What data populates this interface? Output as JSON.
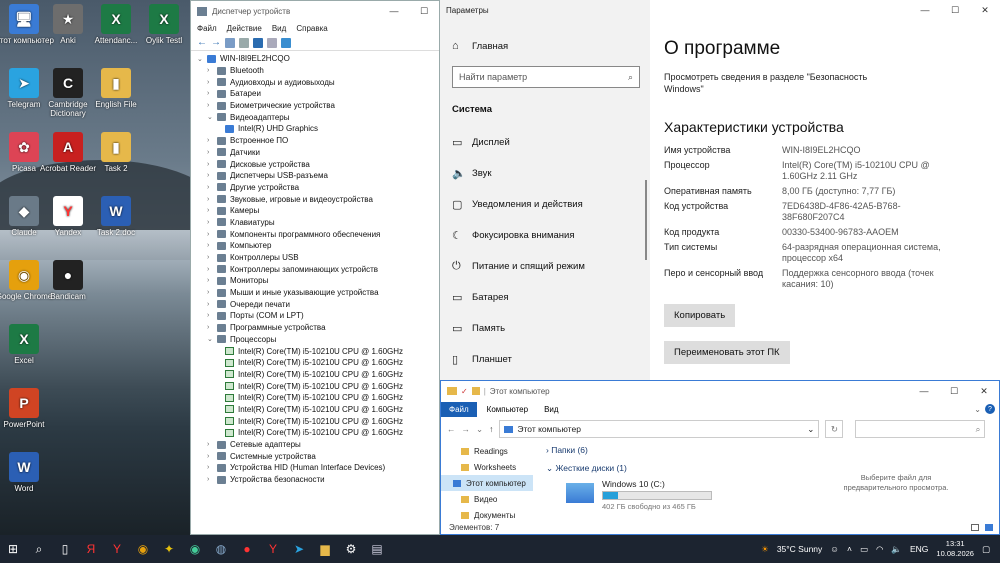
{
  "desktop": {
    "icons": [
      {
        "label": "Этот компьютер",
        "color": "#3a7bd5",
        "glyph": "🖥"
      },
      {
        "label": "Anki",
        "color": "#6d6d6d",
        "glyph": "★"
      },
      {
        "label": "Attendanc...",
        "color": "#1d7a45",
        "glyph": "X"
      },
      {
        "label": "Oylik Testl",
        "color": "#1d7a45",
        "glyph": "X"
      },
      {
        "label": "Telegram",
        "color": "#2aa3e0",
        "glyph": "➤"
      },
      {
        "label": "Cambridge Dictionary",
        "color": "#222",
        "glyph": "C"
      },
      {
        "label": "English File",
        "color": "#e6b84a",
        "glyph": "▮"
      },
      {
        "label": "Picasa",
        "color": "#d45",
        "glyph": "✿"
      },
      {
        "label": "Acrobat Reader",
        "color": "#c8201f",
        "glyph": "A"
      },
      {
        "label": "Task 2",
        "color": "#e6b84a",
        "glyph": "▮"
      },
      {
        "label": "Claude",
        "color": "#6a7a88",
        "glyph": "◆"
      },
      {
        "label": "Yandex",
        "color": "#fff",
        "glyph": "Y"
      },
      {
        "label": "Task 2.doc",
        "color": "#2b5fb4",
        "glyph": "W"
      },
      {
        "label": "Google Chrome",
        "color": "#e5a00d",
        "glyph": "◉"
      },
      {
        "label": "Bandicam",
        "color": "#222",
        "glyph": "●"
      },
      {
        "label": "Excel",
        "color": "#1d7a45",
        "glyph": "X"
      },
      {
        "label": "PowerPoint",
        "color": "#d04423",
        "glyph": "P"
      },
      {
        "label": "Word",
        "color": "#2b5fb4",
        "glyph": "W"
      }
    ]
  },
  "devmgr": {
    "title": "Диспетчер устройств",
    "menu": [
      "Файл",
      "Действие",
      "Вид",
      "Справка"
    ],
    "root": "WIN-I8I9EL2HCQO",
    "items": [
      {
        "t": "Bluetooth",
        "l": 1,
        "a": "›"
      },
      {
        "t": "Аудиовходы и аудиовыходы",
        "l": 1,
        "a": "›"
      },
      {
        "t": "Батареи",
        "l": 1,
        "a": "›"
      },
      {
        "t": "Биометрические устройства",
        "l": 1,
        "a": "›"
      },
      {
        "t": "Видеоадаптеры",
        "l": 1,
        "a": "⌄"
      },
      {
        "t": "Intel(R) UHD Graphics",
        "l": 2,
        "a": ""
      },
      {
        "t": "Встроенное ПО",
        "l": 1,
        "a": "›"
      },
      {
        "t": "Датчики",
        "l": 1,
        "a": "›"
      },
      {
        "t": "Дисковые устройства",
        "l": 1,
        "a": "›"
      },
      {
        "t": "Диспетчеры USB-разъема",
        "l": 1,
        "a": "›"
      },
      {
        "t": "Другие устройства",
        "l": 1,
        "a": "›"
      },
      {
        "t": "Звуковые, игровые и видеоустройства",
        "l": 1,
        "a": "›"
      },
      {
        "t": "Камеры",
        "l": 1,
        "a": "›"
      },
      {
        "t": "Клавиатуры",
        "l": 1,
        "a": "›"
      },
      {
        "t": "Компоненты программного обеспечения",
        "l": 1,
        "a": "›"
      },
      {
        "t": "Компьютер",
        "l": 1,
        "a": "›"
      },
      {
        "t": "Контроллеры USB",
        "l": 1,
        "a": "›"
      },
      {
        "t": "Контроллеры запоминающих устройств",
        "l": 1,
        "a": "›"
      },
      {
        "t": "Мониторы",
        "l": 1,
        "a": "›"
      },
      {
        "t": "Мыши и иные указывающие устройства",
        "l": 1,
        "a": "›"
      },
      {
        "t": "Очереди печати",
        "l": 1,
        "a": "›"
      },
      {
        "t": "Порты (COM и LPT)",
        "l": 1,
        "a": "›"
      },
      {
        "t": "Программные устройства",
        "l": 1,
        "a": "›"
      },
      {
        "t": "Процессоры",
        "l": 1,
        "a": "⌄"
      },
      {
        "t": "Intel(R) Core(TM) i5-10210U CPU @ 1.60GHz",
        "l": 2,
        "a": "",
        "cpu": true
      },
      {
        "t": "Intel(R) Core(TM) i5-10210U CPU @ 1.60GHz",
        "l": 2,
        "a": "",
        "cpu": true
      },
      {
        "t": "Intel(R) Core(TM) i5-10210U CPU @ 1.60GHz",
        "l": 2,
        "a": "",
        "cpu": true
      },
      {
        "t": "Intel(R) Core(TM) i5-10210U CPU @ 1.60GHz",
        "l": 2,
        "a": "",
        "cpu": true
      },
      {
        "t": "Intel(R) Core(TM) i5-10210U CPU @ 1.60GHz",
        "l": 2,
        "a": "",
        "cpu": true
      },
      {
        "t": "Intel(R) Core(TM) i5-10210U CPU @ 1.60GHz",
        "l": 2,
        "a": "",
        "cpu": true
      },
      {
        "t": "Intel(R) Core(TM) i5-10210U CPU @ 1.60GHz",
        "l": 2,
        "a": "",
        "cpu": true
      },
      {
        "t": "Intel(R) Core(TM) i5-10210U CPU @ 1.60GHz",
        "l": 2,
        "a": "",
        "cpu": true
      },
      {
        "t": "Сетевые адаптеры",
        "l": 1,
        "a": "›"
      },
      {
        "t": "Системные устройства",
        "l": 1,
        "a": "›"
      },
      {
        "t": "Устройства HID (Human Interface Devices)",
        "l": 1,
        "a": "›"
      },
      {
        "t": "Устройства безопасности",
        "l": 1,
        "a": "›"
      }
    ]
  },
  "settings": {
    "title": "Параметры",
    "home": "Главная",
    "search_placeholder": "Найти параметр",
    "section": "Система",
    "nav": [
      {
        "label": "Дисплей",
        "icon": "▭"
      },
      {
        "label": "Звук",
        "icon": "🔈"
      },
      {
        "label": "Уведомления и действия",
        "icon": "▢"
      },
      {
        "label": "Фокусировка внимания",
        "icon": "☾"
      },
      {
        "label": "Питание и спящий режим",
        "icon": "⏻"
      },
      {
        "label": "Батарея",
        "icon": "▭"
      },
      {
        "label": "Память",
        "icon": "▭"
      },
      {
        "label": "Планшет",
        "icon": "▯"
      }
    ],
    "page_title": "О программе",
    "security_link": "Просмотреть сведения в разделе \"Безопасность Windows\"",
    "spec_title": "Характеристики устройства",
    "specs": [
      {
        "k": "Имя устройства",
        "v": "WIN-I8I9EL2HCQO"
      },
      {
        "k": "Процессор",
        "v": "Intel(R) Core(TM) i5-10210U CPU @ 1.60GHz   2.11 GHz"
      },
      {
        "k": "Оперативная память",
        "v": "8,00 ГБ (доступно: 7,77 ГБ)"
      },
      {
        "k": "Код устройства",
        "v": "7ED6438D-4F86-42A5-B768-38F680F207C4"
      },
      {
        "k": "Код продукта",
        "v": "00330-53400-96783-AAOEM"
      },
      {
        "k": "Тип системы",
        "v": "64-разрядная операционная система, процессор x64"
      },
      {
        "k": "Перо и сенсорный ввод",
        "v": "Поддержка сенсорного ввода (точек касания: 10)"
      }
    ],
    "copy_btn": "Копировать",
    "rename_btn": "Переименовать этот ПК"
  },
  "explorer": {
    "title": "Этот компьютер",
    "tabs": [
      "Файл",
      "Компьютер",
      "Вид"
    ],
    "address": "Этот компьютер",
    "side": [
      "Readings",
      "Worksheets",
      "Этот компьютер",
      "Видео",
      "Документы"
    ],
    "folders_group": "Папки (6)",
    "drives_group": "Жесткие диски (1)",
    "drive_name": "Windows 10 (C:)",
    "drive_free": "402 ГБ свободно из 465 ГБ",
    "drive_used_fraction": 0.135,
    "preview_text": "Выберите файл для предварительного просмотра.",
    "status": "Элементов: 7"
  },
  "taskbar": {
    "weather": "35°C  Sunny",
    "lang": "ENG",
    "time": "13:31",
    "date": "10.08.2026"
  }
}
